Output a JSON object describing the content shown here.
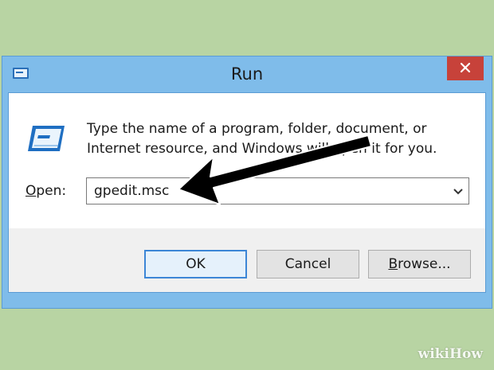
{
  "window": {
    "title": "Run",
    "close_icon": "close-icon"
  },
  "dialog": {
    "prompt": "Type the name of a program, folder, document, or Internet resource, and Windows will open it for you.",
    "open_label_prefix": "",
    "open_label_accel": "O",
    "open_label_rest": "pen:",
    "open_value": "gpedit.msc"
  },
  "buttons": {
    "ok": "OK",
    "cancel": "Cancel",
    "browse_accel": "B",
    "browse_rest": "rowse..."
  },
  "watermark": "wikiHow",
  "colors": {
    "background": "#b8d4a3",
    "frame": "#7fbcea",
    "close": "#c7423a",
    "default_button_border": "#3c86d6"
  }
}
